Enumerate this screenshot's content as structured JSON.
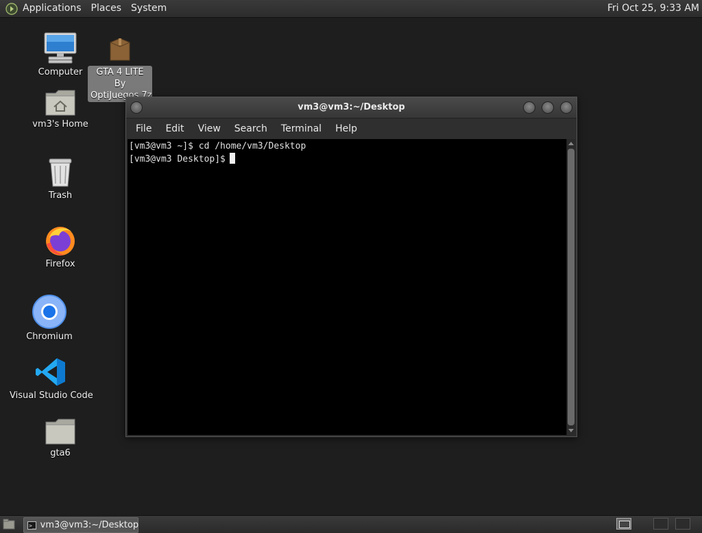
{
  "top_panel": {
    "menus": [
      "Applications",
      "Places",
      "System"
    ],
    "clock": "Fri Oct 25,  9:33 AM"
  },
  "desktop_icons": {
    "computer": "Computer",
    "home": "vm3's Home",
    "trash": "Trash",
    "firefox": "Firefox",
    "chromium": "Chromium",
    "vscode": "Visual Studio Code",
    "gta6": "gta6",
    "archive": "GTA 4 LITE By OptiJuegos.7z"
  },
  "terminal": {
    "title": "vm3@vm3:~/Desktop",
    "menu": [
      "File",
      "Edit",
      "View",
      "Search",
      "Terminal",
      "Help"
    ],
    "lines": [
      "[vm3@vm3 ~]$ cd /home/vm3/Desktop",
      "[vm3@vm3 Desktop]$"
    ]
  },
  "taskbar": {
    "task_label": "vm3@vm3:~/Desktop"
  }
}
